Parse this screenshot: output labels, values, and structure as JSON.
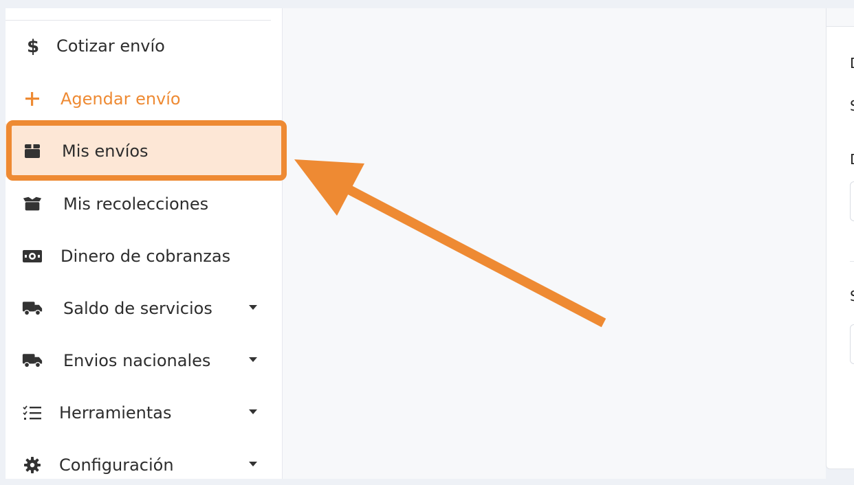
{
  "sidebar": {
    "items": [
      {
        "label": "Cotizar envío",
        "icon": "dollar-icon"
      },
      {
        "label": "Agendar envío",
        "icon": "plus-icon",
        "accent": "#ee8a33"
      },
      {
        "label": "Mis envíos",
        "icon": "package-icon",
        "highlighted": true
      },
      {
        "label": "Mis recolecciones",
        "icon": "open-box-icon"
      },
      {
        "label": "Dinero de cobranzas",
        "icon": "money-bill-icon"
      },
      {
        "label": "Saldo de servicios",
        "icon": "truck-icon",
        "has_dropdown": true
      },
      {
        "label": "Envios nacionales",
        "icon": "truck-icon",
        "has_dropdown": true
      },
      {
        "label": "Herramientas",
        "icon": "checklist-icon",
        "has_dropdown": true
      },
      {
        "label": "Configuración",
        "icon": "gear-icon",
        "has_dropdown": true
      }
    ]
  },
  "right_panel": {
    "letters": [
      "D",
      "S",
      "D",
      "S"
    ]
  },
  "annotation": {
    "highlight_color": "#ee8a33",
    "highlight_fill": "#fde7d6",
    "arrow_color": "#ee8a33"
  }
}
